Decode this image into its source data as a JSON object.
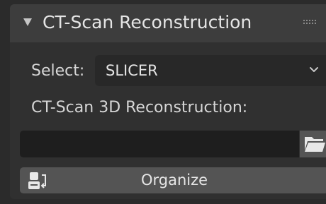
{
  "panel": {
    "title": "CT-Scan Reconstruction",
    "collapse_icon": "disclosure-triangle-down-icon",
    "drag_icon": "drag-handle-icon"
  },
  "select": {
    "label": "Select:",
    "value": "SLICER",
    "icon": "chevron-down-icon"
  },
  "reconstruction": {
    "label": "CT-Scan 3D Reconstruction:",
    "path_value": "",
    "browse_icon": "folder-icon"
  },
  "organize": {
    "label": "Organize",
    "icon": "organize-icon"
  },
  "colors": {
    "background": "#2b2b2b",
    "panel": "#303030",
    "header": "#3d3d3d",
    "field": "#1e1e1e",
    "button": "#545454",
    "text": "#e5e5e5"
  }
}
